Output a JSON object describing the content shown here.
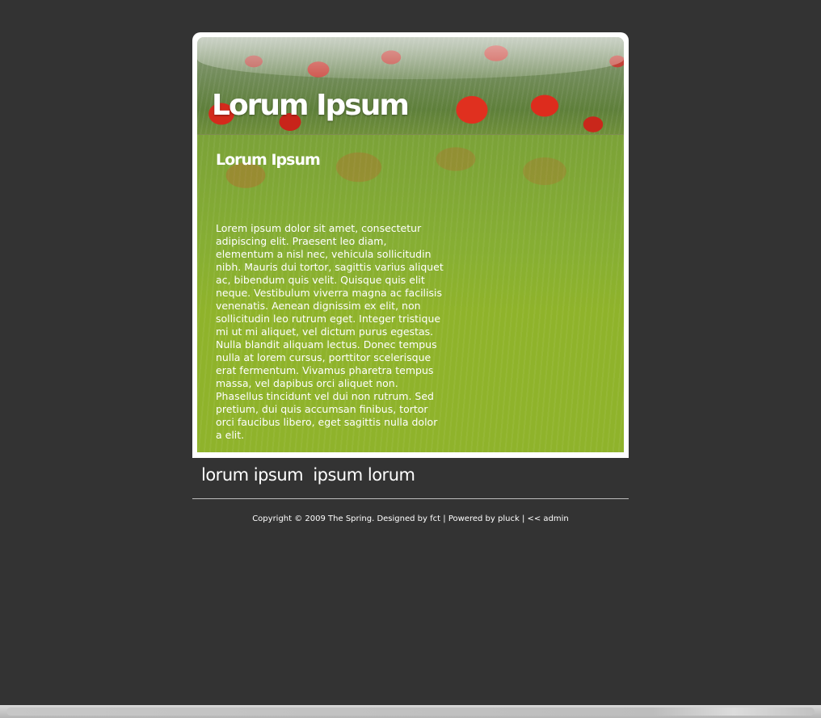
{
  "site": {
    "title": "Lorum Ipsum"
  },
  "content": {
    "heading": "Lorum Ipsum",
    "body": "Lorem ipsum dolor sit amet, consectetur adipiscing elit. Praesent leo diam, elementum a nisl nec, vehicula sollicitudin nibh. Mauris dui tortor, sagittis varius aliquet ac, bibendum quis velit. Quisque quis elit neque. Vestibulum viverra magna ac facilisis venenatis. Aenean dignissim ex elit, non sollicitudin leo rutrum eget. Integer tristique mi ut mi aliquet, vel dictum purus egestas. Nulla blandit aliquam lectus. Donec tempus nulla at lorem cursus, porttitor scelerisque erat fermentum. Vivamus pharetra tempus massa, vel dapibus orci aliquet non. Phasellus tincidunt vel dui non rutrum. Sed pretium, dui quis accumsan finibus, tortor orci faucibus libero, eget sagittis nulla dolor a elit."
  },
  "nav": {
    "items": [
      {
        "label": "lorum ipsum"
      },
      {
        "label": "ipsum lorum"
      }
    ]
  },
  "footer": {
    "copyright": "Copyright © 2009 The Spring. Designed by",
    "designer": "fct",
    "sep1": "|",
    "powered_by": "Powered by",
    "engine": "pluck",
    "sep2": "|",
    "admin": "<< admin"
  },
  "colors": {
    "background": "#333333",
    "content_green": "#8fb32b",
    "frame": "#ffffff"
  }
}
